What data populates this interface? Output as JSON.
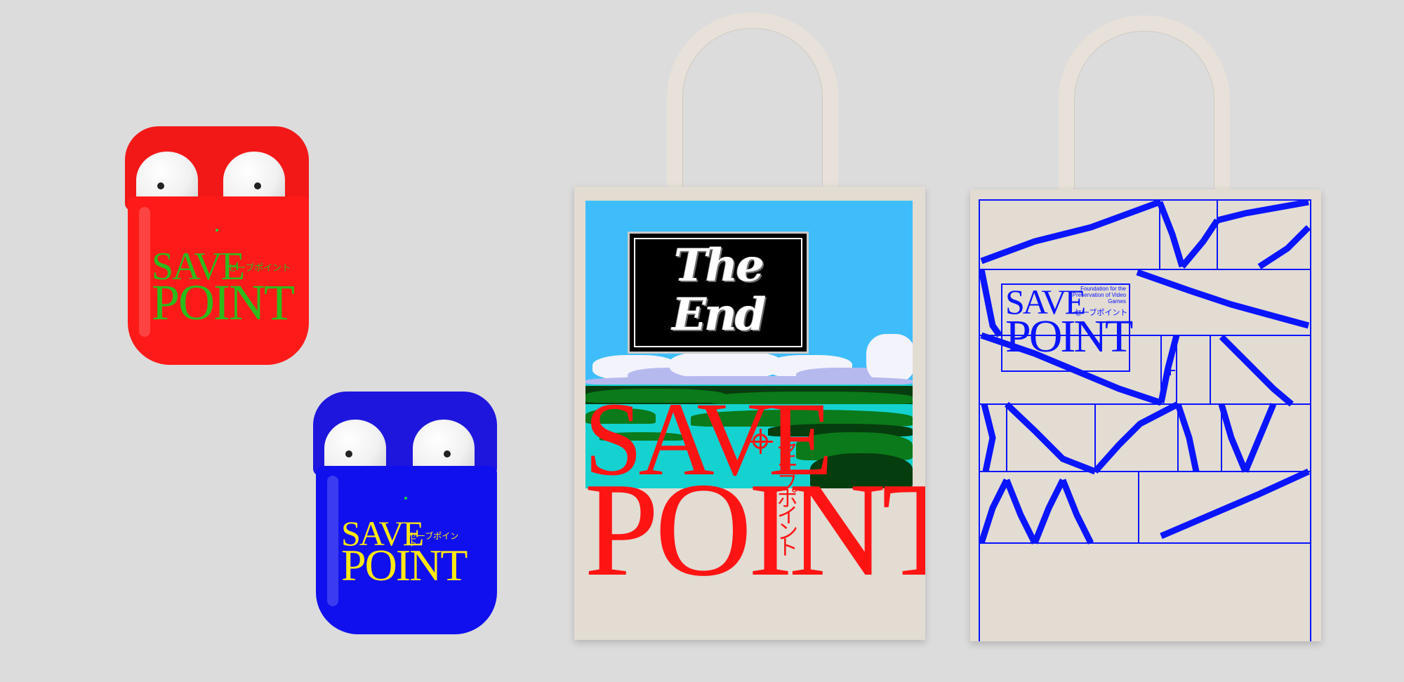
{
  "colors": {
    "background": "#dcdcdc",
    "red_case": "#ff1a1a",
    "red_case_logo": "#2dbb1c",
    "blue_case": "#1010ee",
    "blue_case_logo": "#ffe814",
    "tote_canvas": "#e2dcd3",
    "tote_red_logo": "#ff1414",
    "tote_blue_lines": "#0a14ff",
    "sky": "#3fbdfb"
  },
  "red_case": {
    "line1": "SAVE",
    "line2": "POINT",
    "jp": "セーブポイント"
  },
  "blue_case": {
    "line1": "SAVE",
    "line2": "POINT",
    "jp": "セーブポイント"
  },
  "tote_scene": {
    "sign_line1": "The",
    "sign_line2": "End",
    "line1": "SAVE",
    "line2": "POINT",
    "jp": "セーブポイント"
  },
  "tote_grid": {
    "line1": "SAVE",
    "line2": "POINT",
    "jp": "セーブポイント",
    "foundation": "Foundation for the Preservation of Video Games"
  }
}
